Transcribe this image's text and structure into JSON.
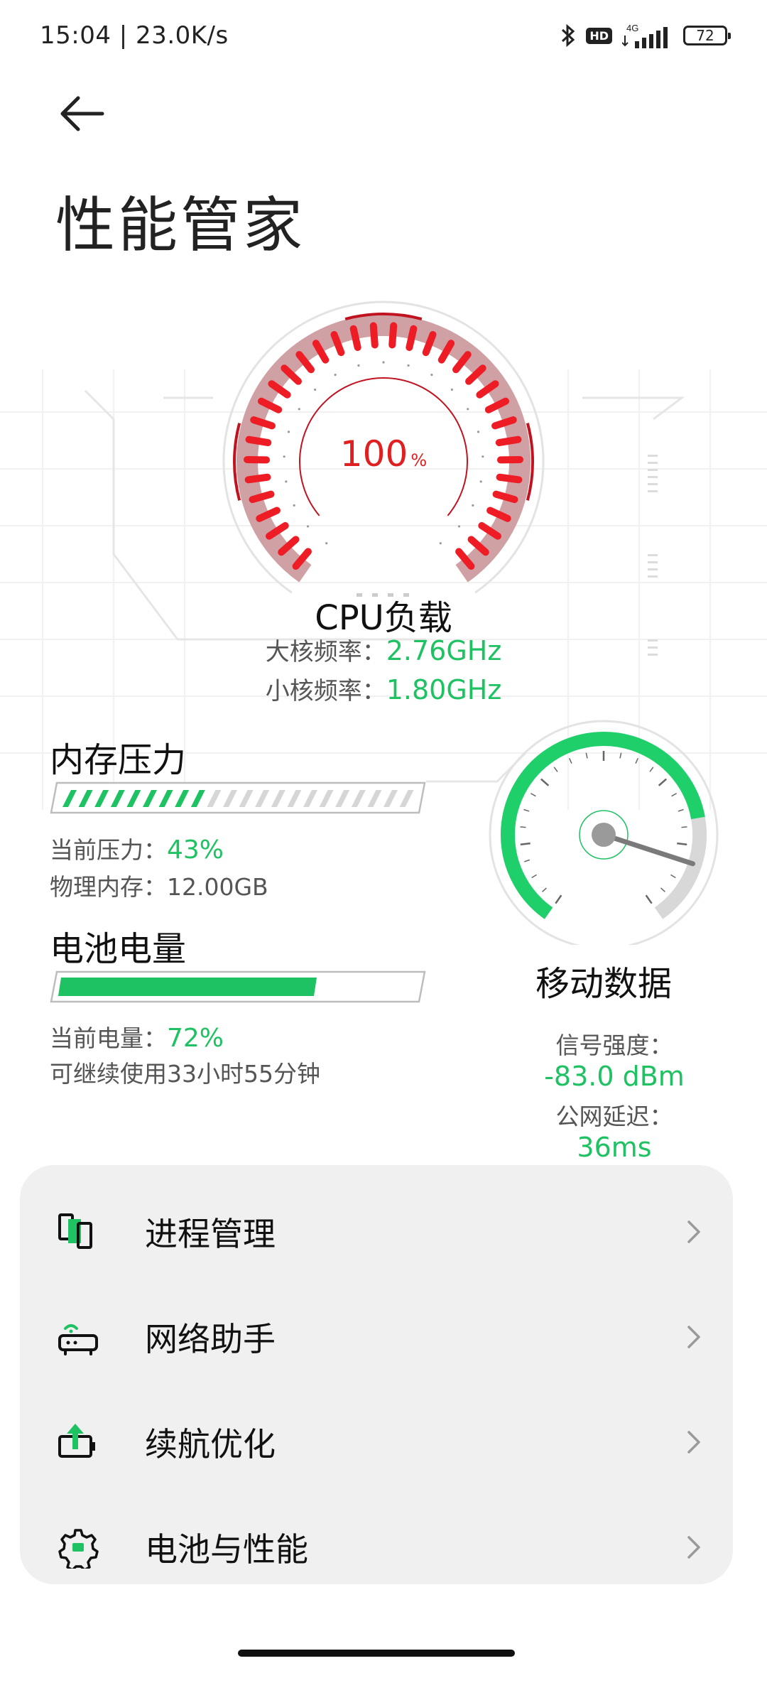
{
  "status_bar": {
    "time": "15:04 | 23.0K/s",
    "hd": "HD",
    "network": "4G",
    "battery": "72",
    "icons": [
      "bluetooth-icon",
      "hd-icon",
      "signal-4g-icon",
      "battery-icon"
    ]
  },
  "header": {
    "back_icon": "arrow-left-icon",
    "title": "性能管家"
  },
  "cpu": {
    "load_value": "100",
    "load_unit": "%",
    "load_fraction": 1.0,
    "label": "CPU负载",
    "big_core_label": "大核频率：",
    "big_core_value": "2.76GHz",
    "small_core_label": "小核频率：",
    "small_core_value": "1.80GHz"
  },
  "memory": {
    "title": "内存压力",
    "pressure_label": "当前压力：",
    "pressure_value": "43%",
    "pressure_fraction": 0.43,
    "physical_label": "物理内存：",
    "physical_value": "12.00GB"
  },
  "battery": {
    "title": "电池电量",
    "level_label": "当前电量：",
    "level_value": "72%",
    "level_fraction": 0.72,
    "remaining": "可继续使用33小时55分钟"
  },
  "mobile_data": {
    "title": "移动数据",
    "signal_label": "信号强度：",
    "signal_value": "-83.0 dBm",
    "latency_label": "公网延迟：",
    "latency_value": "36ms"
  },
  "menu": {
    "items": [
      {
        "label": "进程管理",
        "icon": "process-manager-icon"
      },
      {
        "label": "网络助手",
        "icon": "network-assistant-icon"
      },
      {
        "label": "续航优化",
        "icon": "battery-optimize-icon"
      },
      {
        "label": "电池与性能",
        "icon": "gear-icon"
      }
    ]
  },
  "colors": {
    "accent_green": "#1fc262",
    "cpu_red": "#e02020",
    "card_bg": "#f0f0f0"
  }
}
